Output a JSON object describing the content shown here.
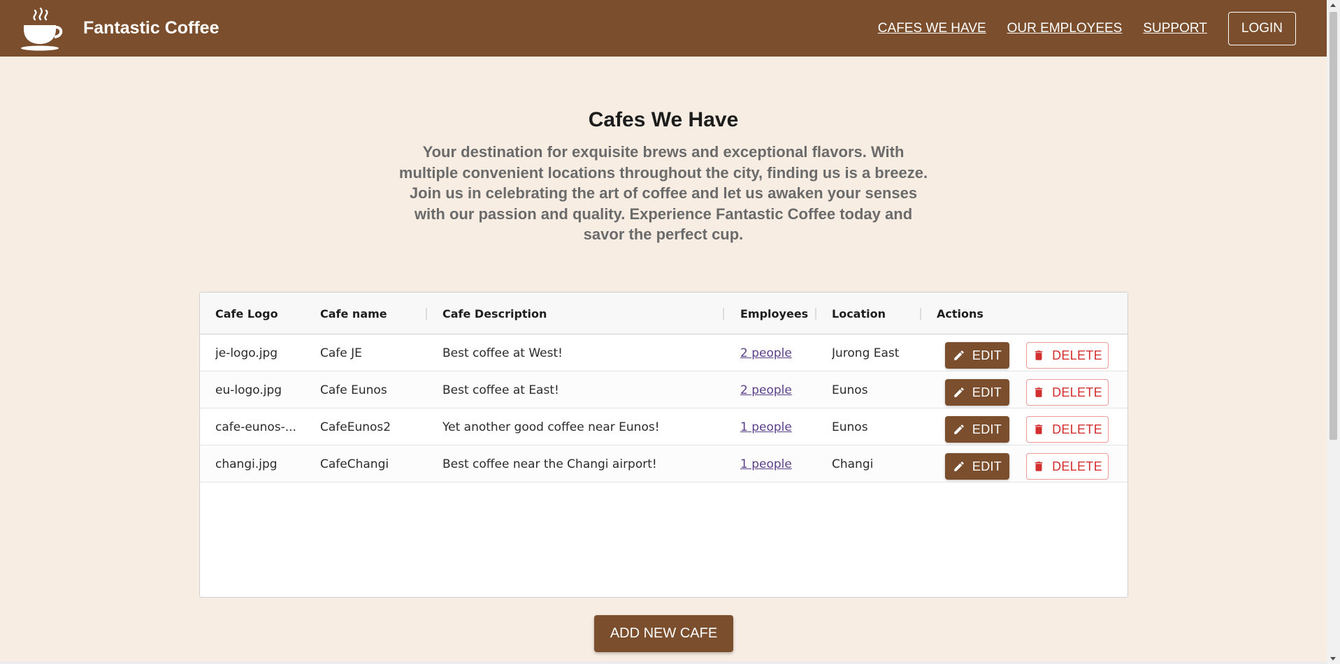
{
  "header": {
    "brand_title": "Fantastic Coffee",
    "nav": [
      "CAFES WE HAVE",
      "OUR EMPLOYEES",
      "SUPPORT"
    ],
    "login_label": "LOGIN"
  },
  "hero": {
    "title": "Cafes We Have",
    "description": "Your destination for exquisite brews and exceptional flavors. With multiple convenient locations throughout the city, finding us is a breeze. Join us in celebrating the art of coffee and let us awaken your senses with our passion and quality. Experience Fantastic Coffee today and savor the perfect cup."
  },
  "table": {
    "columns": [
      "Cafe Logo",
      "Cafe name",
      "Cafe Description",
      "Employees",
      "Location",
      "Actions"
    ],
    "rows": [
      {
        "logo": "je-logo.jpg",
        "name": "Cafe JE",
        "description": "Best coffee at West!",
        "employees": "2 people",
        "location": "Jurong East"
      },
      {
        "logo": "eu-logo.jpg",
        "name": "Cafe Eunos",
        "description": "Best coffee at East!",
        "employees": "2 people",
        "location": "Eunos"
      },
      {
        "logo": "cafe-eunos-...",
        "name": "CafeEunos2",
        "description": "Yet another good coffee near Eunos!",
        "employees": "1 people",
        "location": "Eunos"
      },
      {
        "logo": "changi.jpg",
        "name": "CafeChangi",
        "description": "Best coffee near the Changi airport!",
        "employees": "1 people",
        "location": "Changi"
      }
    ],
    "edit_label": "EDIT",
    "delete_label": "DELETE"
  },
  "add_button_label": "ADD NEW CAFE",
  "colors": {
    "brand_brown": "#7b4f2d",
    "page_background": "#f7ede3",
    "delete_red": "#d32f2f",
    "link_purple": "#5b3f8a"
  },
  "icons": {
    "logo": "coffee-cup-icon",
    "edit": "pencil-icon",
    "delete": "trash-icon"
  }
}
